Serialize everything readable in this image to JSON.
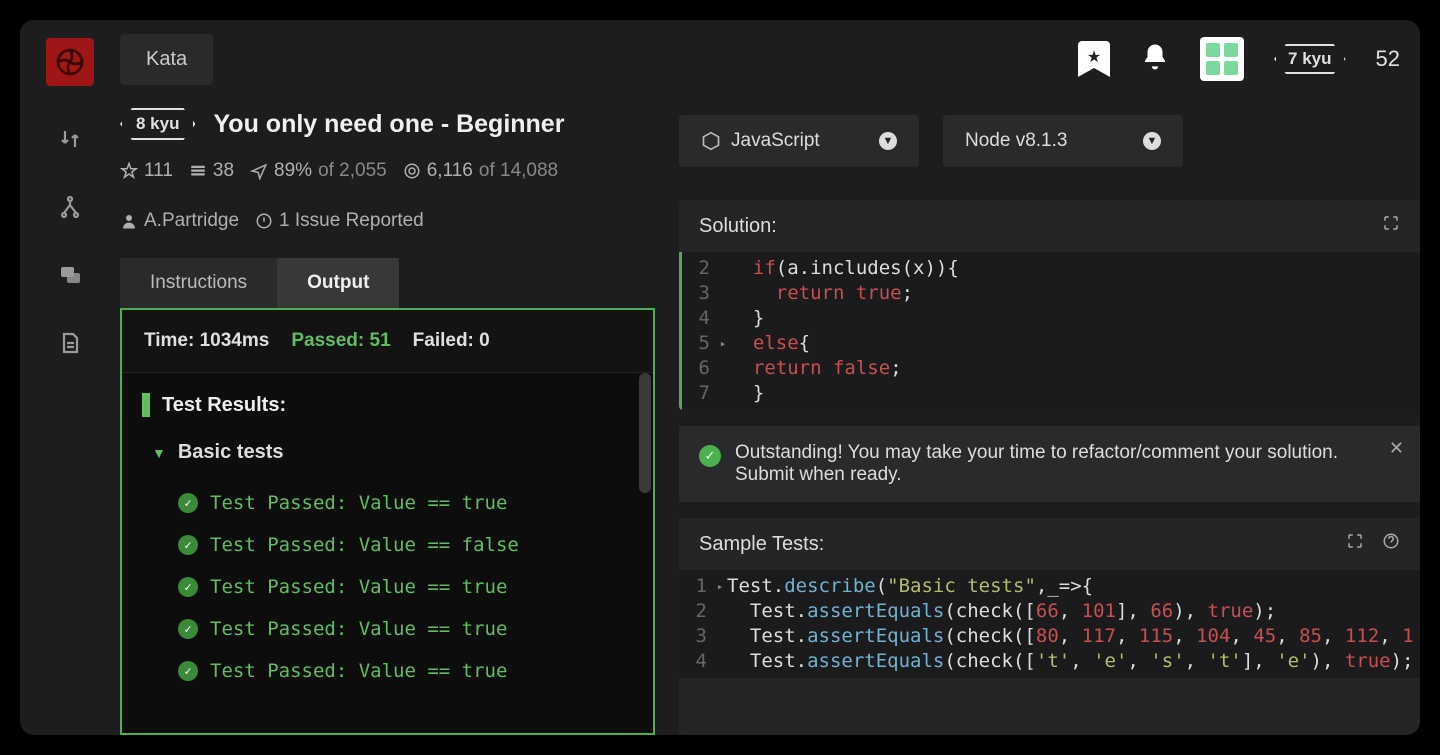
{
  "topbar": {
    "section": "Kata",
    "user_rank": "7 kyu",
    "honor": "52"
  },
  "kata": {
    "rank": "8 kyu",
    "title": "You only need one - Beginner",
    "stars": "111",
    "collections": "38",
    "satisfaction_pct": "89%",
    "satisfaction_of": "of 2,055",
    "completed": "6,116",
    "completed_of": "of 14,088",
    "author": "A.Partridge",
    "issues": "1 Issue Reported"
  },
  "tabs": {
    "instructions": "Instructions",
    "output": "Output"
  },
  "output": {
    "time_label": "Time: 1034ms",
    "passed_label": "Passed: 51",
    "failed_label": "Failed: 0",
    "results_header": "Test Results:",
    "group": "Basic tests",
    "lines": [
      "Test Passed: Value == true",
      "Test Passed: Value == false",
      "Test Passed: Value == true",
      "Test Passed: Value == true",
      "Test Passed: Value == true"
    ]
  },
  "language_select": {
    "label": "JavaScript"
  },
  "runtime_select": {
    "label": "Node v8.1.3"
  },
  "solution": {
    "header": "Solution:",
    "lines": [
      {
        "n": "2",
        "fold": "",
        "html": "  <span class='tk-kw'>if</span>(a.includes(x)){"
      },
      {
        "n": "3",
        "fold": "",
        "html": "    <span class='tk-kw'>return</span> <span class='tk-bool'>true</span>;"
      },
      {
        "n": "4",
        "fold": "",
        "html": "  }"
      },
      {
        "n": "5",
        "fold": "▸",
        "html": "  <span class='tk-kw'>else</span>{"
      },
      {
        "n": "6",
        "fold": "",
        "html": "  <span class='tk-kw'>return</span> <span class='tk-bool'>false</span>;"
      },
      {
        "n": "7",
        "fold": "",
        "html": "  }"
      }
    ]
  },
  "notice": {
    "text": "Outstanding! You may take your time to refactor/comment your solution. Submit when ready."
  },
  "sample": {
    "header": "Sample Tests:",
    "lines": [
      {
        "n": "1",
        "fold": "▸",
        "html": "Test.<span class='tk-fn'>describe</span>(<span class='tk-str'>\"Basic tests\"</span>,_=&gt;{"
      },
      {
        "n": "2",
        "fold": "",
        "html": "  Test.<span class='tk-fn'>assertEquals</span>(check([<span class='tk-num'>66</span>, <span class='tk-num'>101</span>], <span class='tk-num'>66</span>), <span class='tk-bool'>true</span>);"
      },
      {
        "n": "3",
        "fold": "",
        "html": "  Test.<span class='tk-fn'>assertEquals</span>(check([<span class='tk-num'>80</span>, <span class='tk-num'>117</span>, <span class='tk-num'>115</span>, <span class='tk-num'>104</span>, <span class='tk-num'>45</span>, <span class='tk-num'>85</span>, <span class='tk-num'>112</span>, <span class='tk-num'>1</span>"
      },
      {
        "n": "4",
        "fold": "",
        "html": "  Test.<span class='tk-fn'>assertEquals</span>(check([<span class='tk-str'>'t'</span>, <span class='tk-str'>'e'</span>, <span class='tk-str'>'s'</span>, <span class='tk-str'>'t'</span>], <span class='tk-str'>'e'</span>), <span class='tk-bool'>true</span>);"
      }
    ]
  }
}
